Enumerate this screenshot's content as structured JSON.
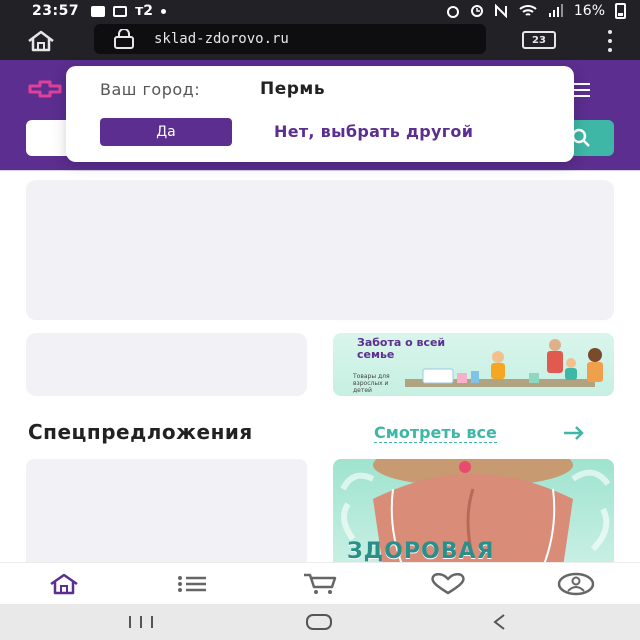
{
  "status_bar": {
    "time": "23:57",
    "carrier": "т2",
    "battery": "16%"
  },
  "browser": {
    "url": "sklad-zdorovo.ru",
    "tab_count": "23"
  },
  "city_popup": {
    "label": "Ваш город:",
    "city": "Пермь",
    "yes_label": "Да",
    "other_label": "Нет, выбрать другой"
  },
  "banners": {
    "family_title": "Забота о всей семье",
    "family_subtitle": "Товары для взрослых и детей",
    "health_title": "ЗДОРОВАЯ"
  },
  "special": {
    "title": "Спецпредложения",
    "see_all": "Смотреть все"
  },
  "bottom_nav": [
    "home-icon",
    "catalog-icon",
    "cart-icon",
    "favorites-icon",
    "profile-icon"
  ],
  "colors": {
    "brand_purple": "#5b2e8f",
    "accent_teal": "#3eb7a6",
    "logo_pink": "#e0409a"
  }
}
